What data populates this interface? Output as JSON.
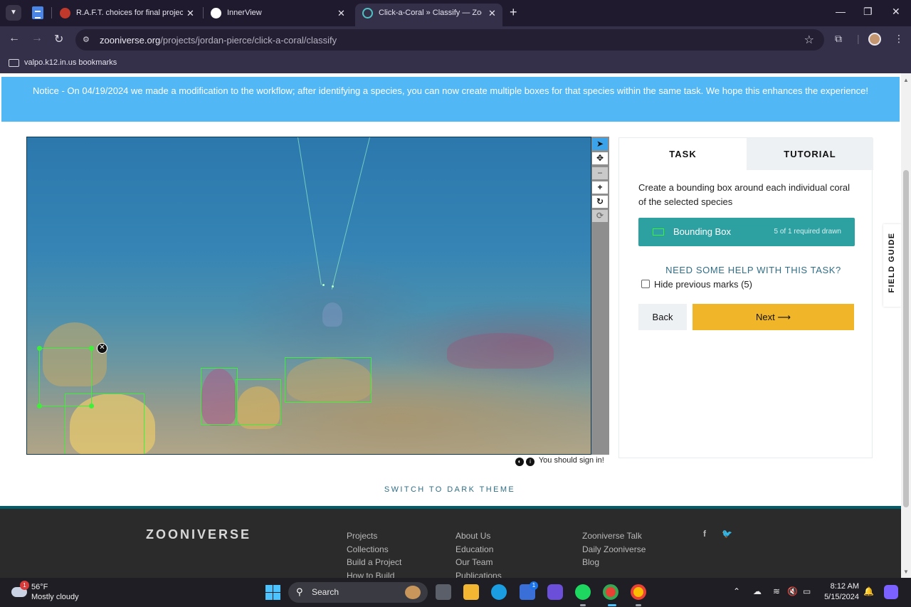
{
  "browser": {
    "tabs": [
      {
        "title": "R.A.F.T. choices for final project"
      },
      {
        "title": "InnerView"
      },
      {
        "title": "Click-a-Coral » Classify — Zoon"
      }
    ],
    "url_domain": "zooniverse.org",
    "url_path": "/projects/jordan-pierce/click-a-coral/classify",
    "bookmark_folder": "valpo.k12.in.us bookmarks"
  },
  "notice": {
    "text": "Notice - On 04/19/2024 we made a modification to the workflow; after identifying a species, you can now create multiple boxes for that species within the same task. We hope this enhances the experience!"
  },
  "image_toolbar": {
    "tools": [
      "pointer-icon",
      "move-icon",
      "zoom-out-icon",
      "zoom-in-icon",
      "rotate-icon",
      "reset-icon"
    ]
  },
  "status": {
    "sign_in": "You should sign in!"
  },
  "task_panel": {
    "tab_task": "TASK",
    "tab_tutorial": "TUTORIAL",
    "instruction": "Create a bounding box around each individual coral of the selected species",
    "tool_label": "Bounding Box",
    "tool_count": "5 of 1 required drawn",
    "help": "NEED SOME HELP WITH THIS TASK?",
    "hide_marks": "Hide previous marks (5)",
    "back": "Back",
    "next": "Next ⟶",
    "box_color": "#3ff03a"
  },
  "field_guide": "FIELD GUIDE",
  "dark_theme": "SWITCH TO DARK THEME",
  "footer": {
    "logo": "ZOONIVERSE",
    "col1": [
      "Projects",
      "Collections",
      "Build a Project",
      "How to Build"
    ],
    "col2": [
      "About Us",
      "Education",
      "Our Team",
      "Publications"
    ],
    "col3": [
      "Zooniverse Talk",
      "Daily Zooniverse",
      "Blog"
    ]
  },
  "taskbar": {
    "weather_temp": "56°F",
    "weather_desc": "Mostly cloudy",
    "weather_badge": "1",
    "search": "Search",
    "store_badge": "1",
    "time": "8:12 AM",
    "date": "5/15/2024"
  }
}
